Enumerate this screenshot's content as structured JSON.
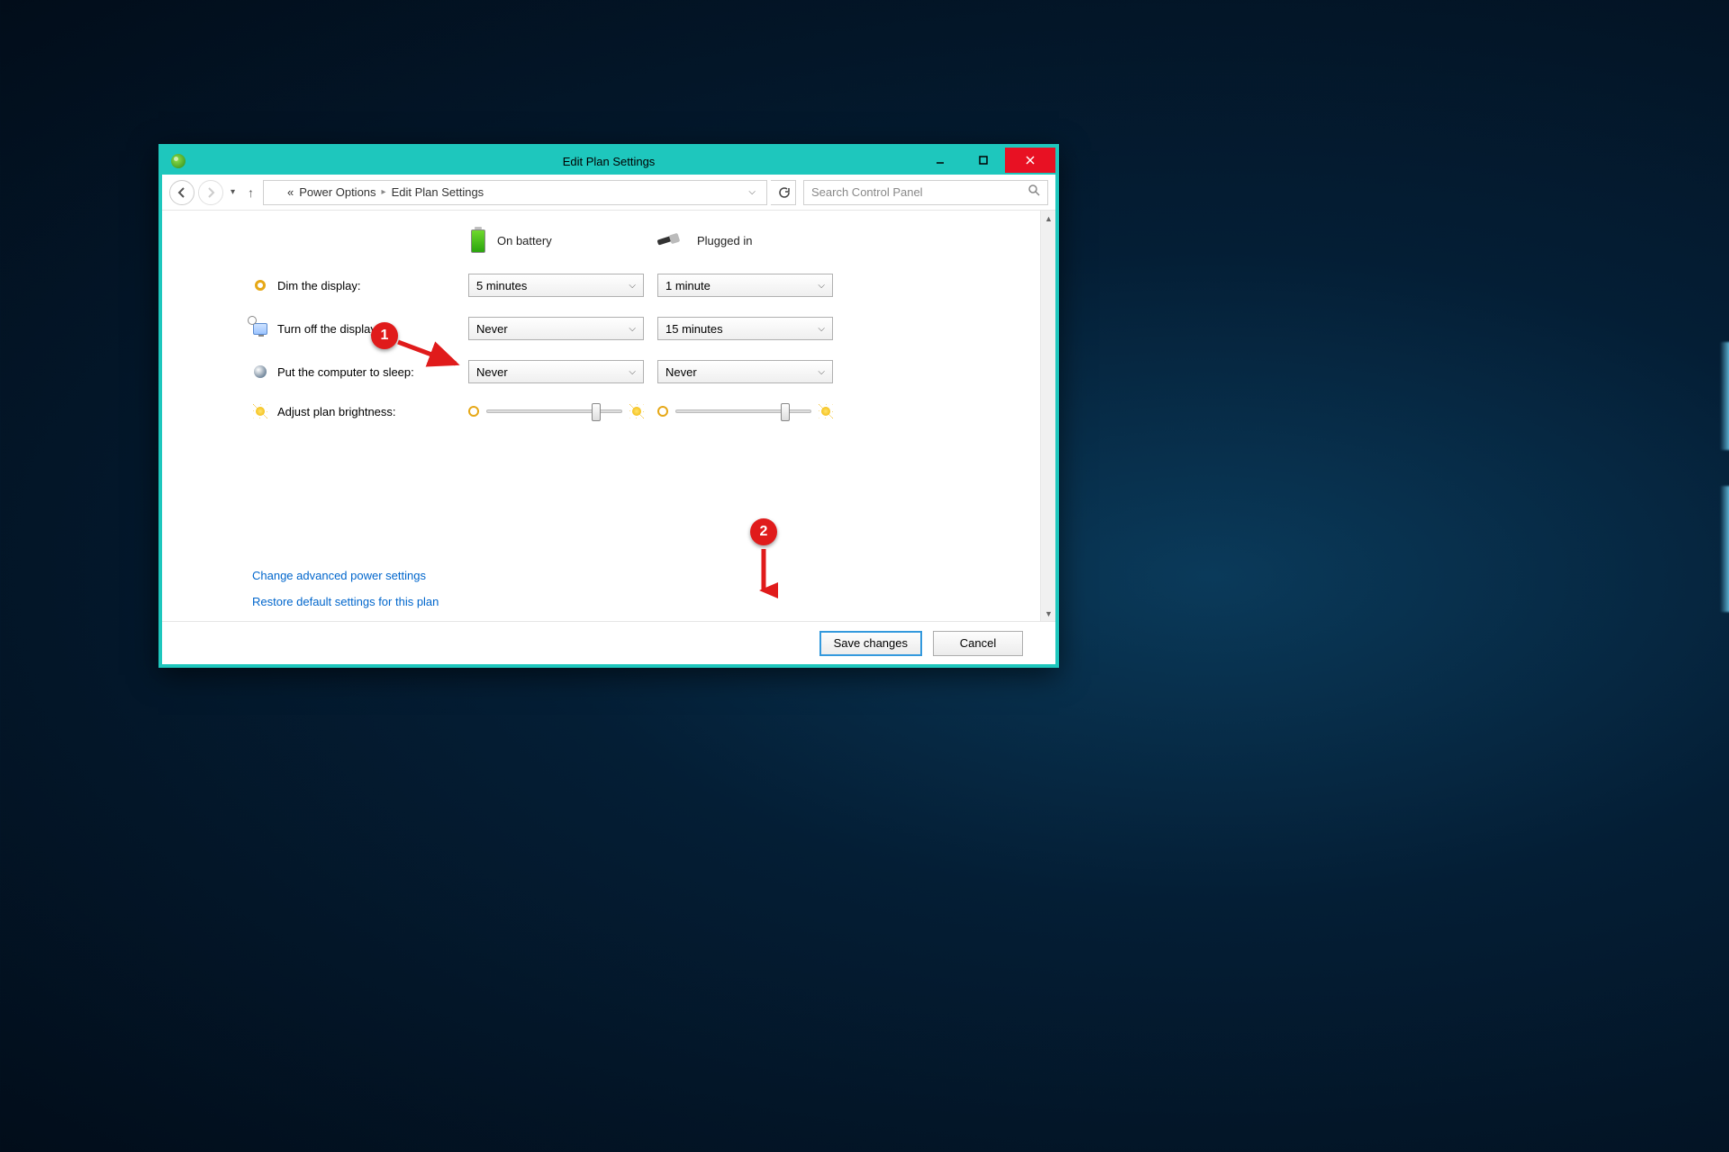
{
  "window": {
    "title": "Edit Plan Settings"
  },
  "breadcrumb": {
    "prefix": "«",
    "part1": "Power Options",
    "part2": "Edit Plan Settings"
  },
  "search": {
    "placeholder": "Search Control Panel"
  },
  "columns": {
    "battery": "On battery",
    "plugged": "Plugged in"
  },
  "settings": {
    "dim": {
      "label": "Dim the display:",
      "battery": "5 minutes",
      "plugged": "1 minute"
    },
    "off": {
      "label": "Turn off the display:",
      "battery": "Never",
      "plugged": "15 minutes"
    },
    "sleep": {
      "label": "Put the computer to sleep:",
      "battery": "Never",
      "plugged": "Never"
    },
    "bright": {
      "label": "Adjust plan brightness:"
    }
  },
  "links": {
    "advanced": "Change advanced power settings",
    "restore": "Restore default settings for this plan"
  },
  "buttons": {
    "save": "Save changes",
    "cancel": "Cancel"
  },
  "annotations": {
    "one": "1",
    "two": "2"
  }
}
